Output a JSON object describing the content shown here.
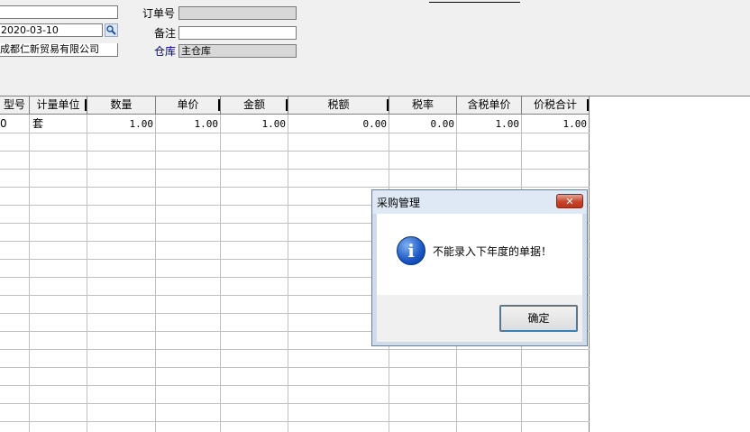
{
  "form": {
    "top_field_value": "",
    "date_value": "2020-03-10",
    "supplier_value": "成都仁新贸易有限公司",
    "order_no_label": "订单号",
    "order_no_value": "",
    "note_label": "备注",
    "note_value": "",
    "warehouse_label": "仓库",
    "warehouse_value": "主仓库",
    "lookup_icon": "magnifier-icon"
  },
  "grid": {
    "headers": [
      "型号",
      "计量单位",
      "数量",
      "单价",
      "金额",
      "税额",
      "税率",
      "含税单价",
      "价税合计"
    ],
    "rows": [
      {
        "model": "0",
        "unit": "套",
        "qty": "1.00",
        "price": "1.00",
        "amount": "1.00",
        "tax": "0.00",
        "tax_rate": "0.00",
        "price_with_tax": "1.00",
        "total": "1.00"
      }
    ]
  },
  "dialog": {
    "title": "采购管理",
    "close_glyph": "✕",
    "icon": "info-icon",
    "icon_glyph": "i",
    "message": "不能录入下年度的单据！",
    "ok_label": "确定"
  },
  "colors": {
    "close_button": "#c7442b",
    "dialog_frame": "#cfdcec",
    "warehouse_label": "#000080"
  }
}
